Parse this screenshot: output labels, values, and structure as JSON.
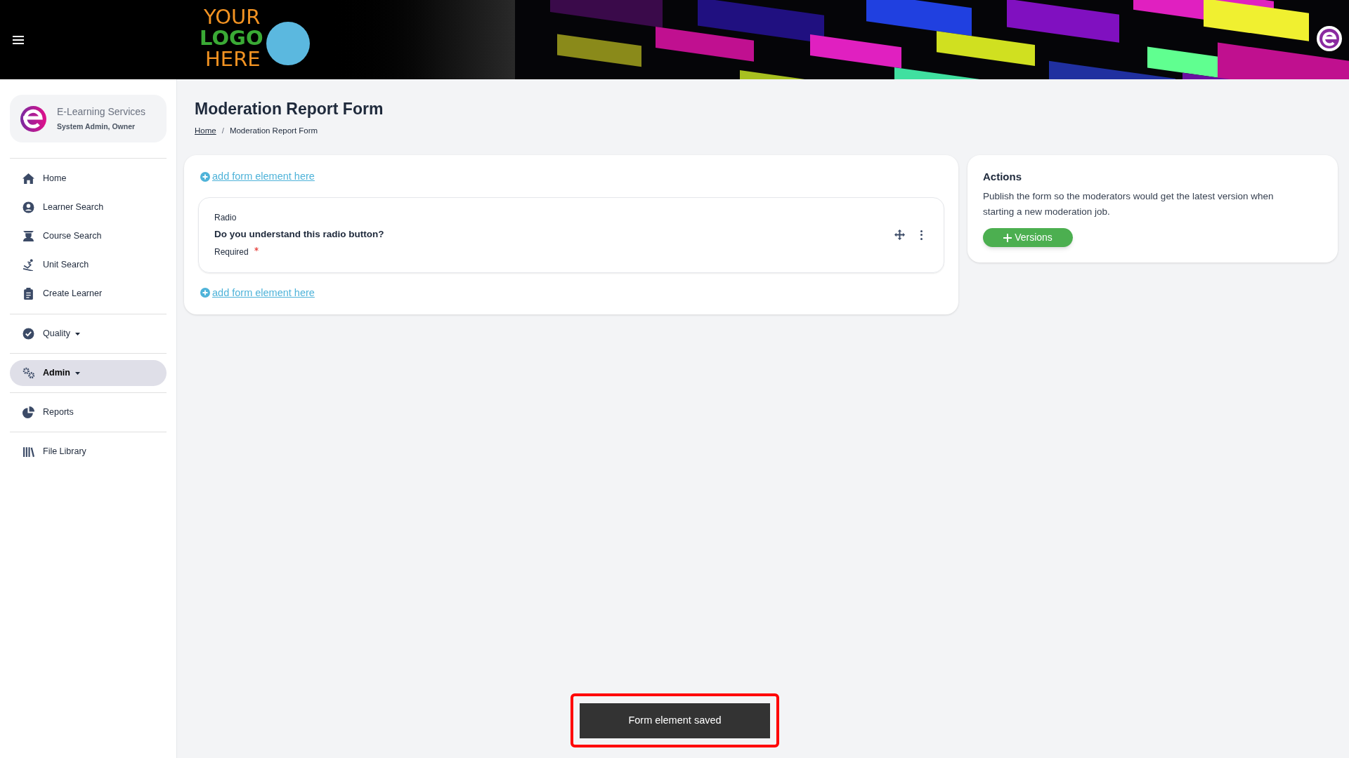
{
  "header": {
    "logo": {
      "line_1": "YOUR",
      "line_2": "LOGO",
      "line_3": "HERE"
    }
  },
  "sidebar": {
    "account": {
      "name": "E-Learning Services",
      "role": "System Admin, Owner"
    },
    "groups": [
      [
        {
          "label": "Home",
          "kind": "home",
          "selected": false,
          "has_menu": false
        },
        {
          "label": "Learner Search",
          "kind": "user",
          "selected": false,
          "has_menu": false
        },
        {
          "label": "Course Search",
          "kind": "graduate",
          "selected": false,
          "has_menu": false
        },
        {
          "label": "Unit Search",
          "kind": "skier",
          "selected": false,
          "has_menu": false
        },
        {
          "label": "Create Learner",
          "kind": "clipboard",
          "selected": false,
          "has_menu": false
        }
      ],
      [
        {
          "label": "Quality",
          "kind": "check",
          "selected": false,
          "has_menu": true
        }
      ],
      [
        {
          "label": "Admin",
          "kind": "gears",
          "selected": true,
          "has_menu": true
        }
      ],
      [
        {
          "label": "Reports",
          "kind": "pie",
          "selected": false,
          "has_menu": false
        }
      ],
      [
        {
          "label": "File Library",
          "kind": "books",
          "selected": false,
          "has_menu": false
        }
      ]
    ]
  },
  "page": {
    "title": "Moderation Report Form",
    "breadcrumb_separator": "/",
    "breadcrumb": [
      {
        "label": "Home",
        "link": true
      },
      {
        "label": "Moderation Report Form",
        "link": false
      }
    ]
  },
  "form": {
    "add_links": [
      "add form element here",
      "add form element here"
    ],
    "elements": [
      {
        "type_label": "Radio",
        "question": "Do you understand this radio button?",
        "required_label": "Required",
        "required": true
      }
    ]
  },
  "actions": {
    "title": "Actions",
    "text": "Publish the form so the moderators would get the latest version when starting a new moderation job.",
    "button": "Versions"
  },
  "toast": {
    "message": "Form element saved"
  }
}
